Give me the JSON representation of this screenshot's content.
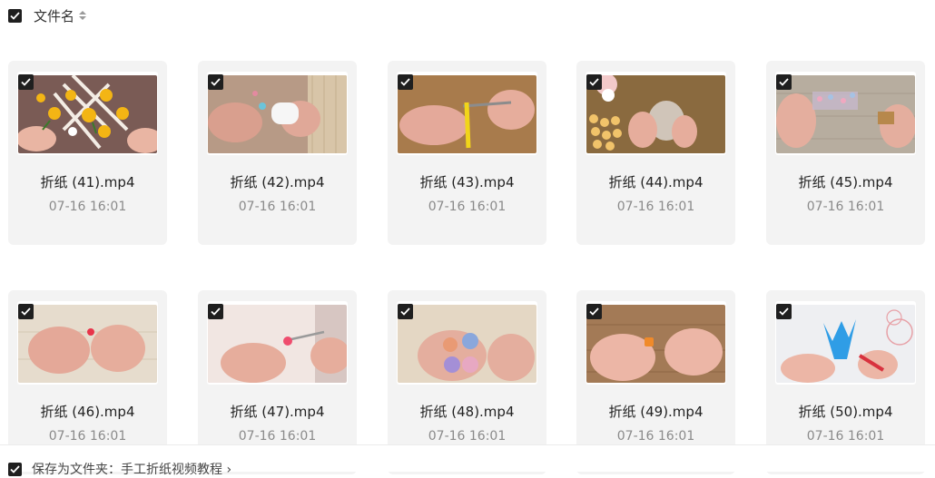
{
  "header": {
    "label": "文件名"
  },
  "files": [
    {
      "name": "折纸 (41).mp4",
      "date": "07-16 16:01"
    },
    {
      "name": "折纸 (42).mp4",
      "date": "07-16 16:01"
    },
    {
      "name": "折纸 (43).mp4",
      "date": "07-16 16:01"
    },
    {
      "name": "折纸 (44).mp4",
      "date": "07-16 16:01"
    },
    {
      "name": "折纸 (45).mp4",
      "date": "07-16 16:01"
    },
    {
      "name": "折纸 (46).mp4",
      "date": "07-16 16:01"
    },
    {
      "name": "折纸 (47).mp4",
      "date": "07-16 16:01"
    },
    {
      "name": "折纸 (48).mp4",
      "date": "07-16 16:01"
    },
    {
      "name": "折纸 (49).mp4",
      "date": "07-16 16:01"
    },
    {
      "name": "折纸 (50).mp4",
      "date": "07-16 16:01"
    }
  ],
  "footer": {
    "save_label": "保存为文件夹：手工折纸视频教程 ›"
  },
  "colors": {
    "checkbox": "#1f1f1f",
    "card_bg": "#f3f3f3",
    "date_text": "#8a8a8a"
  }
}
